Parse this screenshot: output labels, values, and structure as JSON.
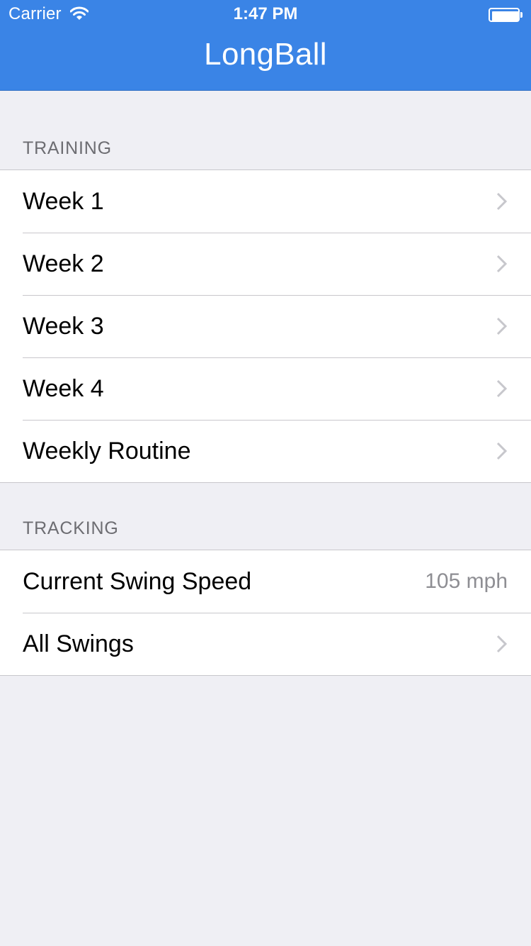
{
  "status_bar": {
    "carrier": "Carrier",
    "time": "1:47 PM"
  },
  "nav": {
    "title": "LongBall"
  },
  "sections": {
    "training": {
      "header": "TRAINING",
      "items": [
        {
          "label": "Week 1"
        },
        {
          "label": "Week 2"
        },
        {
          "label": "Week 3"
        },
        {
          "label": "Week 4"
        },
        {
          "label": "Weekly Routine"
        }
      ]
    },
    "tracking": {
      "header": "TRACKING",
      "items": [
        {
          "label": "Current Swing Speed",
          "value": "105 mph"
        },
        {
          "label": "All Swings"
        }
      ]
    }
  },
  "icons": {
    "wifi": "wifi-icon",
    "battery": "battery-icon",
    "disclosure": "chevron-right-icon"
  },
  "colors": {
    "nav_background": "#3a84e6",
    "page_background": "#efeff4",
    "section_header_text": "#6d6d72",
    "detail_text": "#8e8e93",
    "separator": "#c8c7cc",
    "chevron": "#c7c7cc"
  }
}
